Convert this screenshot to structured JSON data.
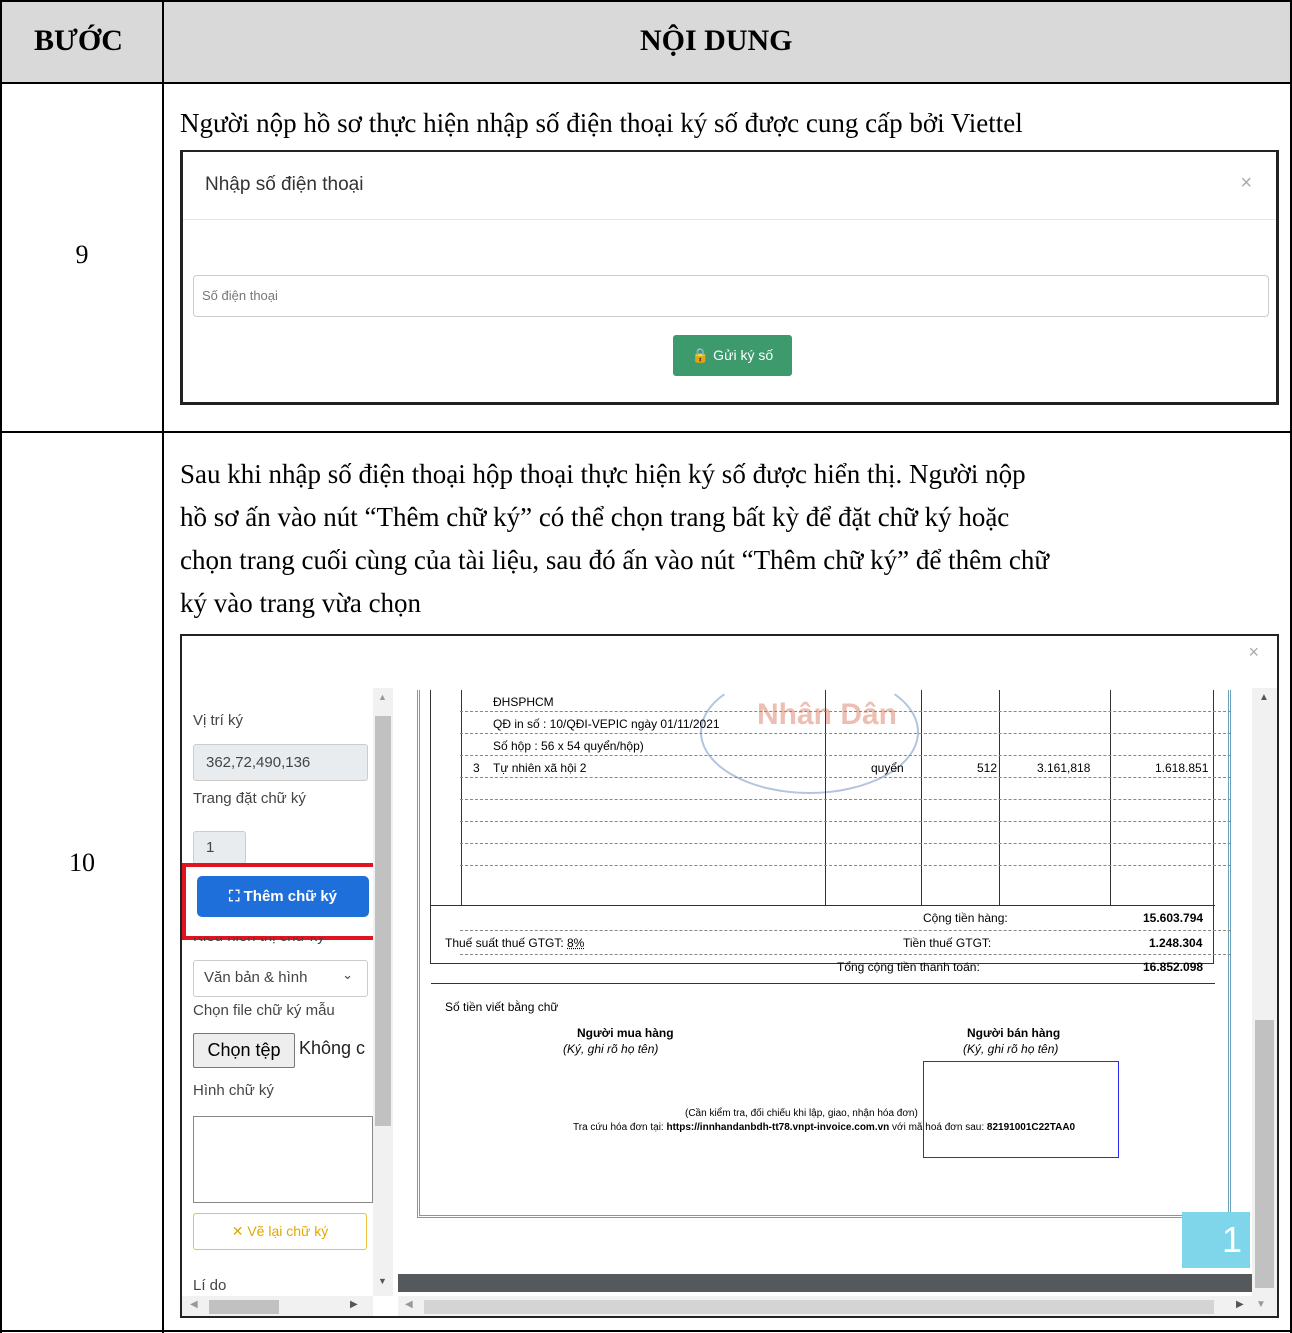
{
  "header": {
    "step": "BƯỚC",
    "content": "NỘI DUNG"
  },
  "step9": {
    "num": "9",
    "text": "Người nộp hồ sơ thực hiện nhập số điện thoại ký số được cung cấp bởi Viettel",
    "dialog": {
      "title": "Nhập số điện thoại",
      "close": "×",
      "placeholder": "Số điện thoại",
      "button": "🔒 Gửi ký số"
    }
  },
  "step10": {
    "num": "10",
    "lines": [
      "Sau khi nhập số điện thoại hộp thoại thực hiện ký số được hiển thị. Người nộp",
      "hồ sơ ấn vào nút “Thêm chữ ký” có thể chọn trang bất kỳ để đặt chữ ký hoặc",
      "chọn trang cuối cùng của tài liệu, sau đó ấn vào nút “Thêm chữ ký” để thêm chữ",
      "ký vào trang vừa chọn"
    ],
    "dialog": {
      "close": "×",
      "position_label": "Vị trí ký",
      "position_value": "362,72,490,136",
      "page_label": "Trang đặt chữ ký",
      "page_value": "1",
      "add_button": "Thêm chữ ký",
      "display_label": "Kiểu hiển thị chữ ký",
      "display_value": "Văn bản & hình",
      "file_label": "Chọn file chữ ký mẫu",
      "file_button": "Chọn tệp",
      "file_status": "Không c",
      "image_label": "Hình chữ ký",
      "redraw_button": "✕ Vẽ lại chữ ký",
      "reason_label": "Lí do",
      "page_badge": "1"
    },
    "invoice": {
      "watermark": "Nhân Dân",
      "rows": [
        {
          "text": "ĐHSPHCM"
        },
        {
          "text": "QĐ in số : 10/QĐI-VEPIC ngày 01/11/2021"
        },
        {
          "text": "Số hộp : 56 x 54 quyển/hộp)"
        }
      ],
      "item": {
        "no": "3",
        "name": "Tự nhiên xã hội 2",
        "unit": "quyển",
        "qty": "512",
        "price": "3.161,818",
        "amount": "1.618.851"
      },
      "subtotal_label": "Cộng tiền hàng:",
      "subtotal": "15.603.794",
      "vat_rate_label": "Thuế suất thuế GTGT:",
      "vat_rate": "8%",
      "vat_label": "Tiền thuế GTGT:",
      "vat": "1.248.304",
      "total_label": "Tổng cộng tiền thanh toán:",
      "total": "16.852.098",
      "words_label": "Số tiền viết bằng chữ",
      "buyer": "Người mua hàng",
      "buyer_note": "(Ký, ghi rõ họ tên)",
      "seller": "Người bán hàng",
      "seller_note": "(Ký, ghi rõ họ tên)",
      "check_note": "(Cần kiểm tra, đối chiếu khi lập, giao, nhận hóa đơn)",
      "lookup_prefix": "Tra cứu hóa đơn tại:",
      "lookup_url": "https://innhandanbdh-tt78.vnpt-invoice.com.vn",
      "lookup_mid": "với mã hoá đơn sau:",
      "lookup_code": "82191001C22TAA0"
    }
  }
}
